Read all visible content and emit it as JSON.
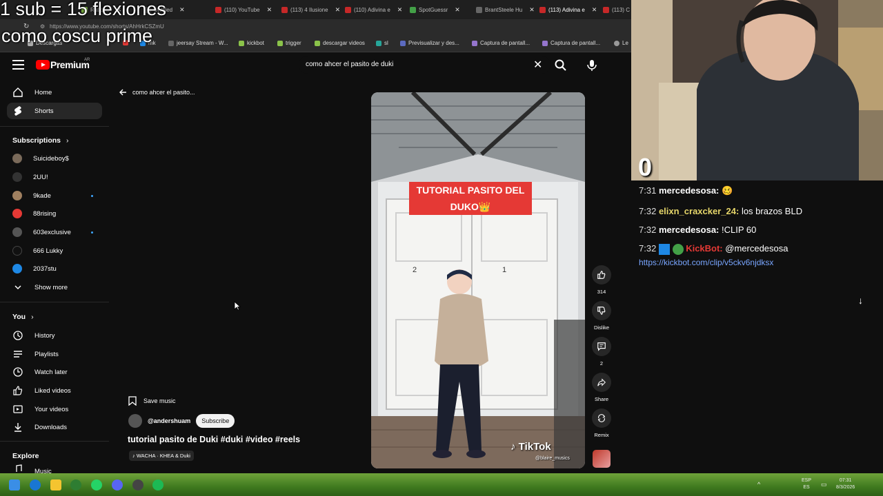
{
  "stream_overlay": {
    "line1": "1 sub = 15 flexiones",
    "line2": "como coscu prime",
    "counter": "0"
  },
  "browser": {
    "tabs": [
      {
        "label": "Ratio ..."
      },
      {
        "label": "Untitled"
      },
      {
        "label": "(110) YouTube"
      },
      {
        "label": "(113) 4 Ilusione"
      },
      {
        "label": "(110) Adivina e"
      },
      {
        "label": "SpotGuessr"
      },
      {
        "label": "BrantSteele Hu"
      },
      {
        "label": "(113) Adivina e"
      },
      {
        "label": "(113) C"
      }
    ],
    "url": "https://www.youtube.com/shorts/AhHrkCSZmU",
    "bookmarks": [
      "Descargas",
      "",
      "mk",
      "jeersay Stream - W...",
      "kickbot",
      "trigger",
      "descargar videos",
      "sl",
      "Previsualizar y des...",
      "Captura de pantall...",
      "Captura de pantall...",
      "Le"
    ]
  },
  "youtube": {
    "logo": "Premium",
    "region": "AR",
    "search_value": "como ahcer el pasito de duki",
    "sidebar": {
      "main": [
        {
          "label": "Home"
        },
        {
          "label": "Shorts"
        }
      ],
      "subscriptions_title": "Subscriptions",
      "subscriptions": [
        {
          "label": "Suicideboy$",
          "color": "#7a6a5a"
        },
        {
          "label": "2UU!",
          "color": "#333333"
        },
        {
          "label": "9kade",
          "color": "#a08060"
        },
        {
          "label": "88rising",
          "color": "#e53935"
        },
        {
          "label": "603exclusive",
          "color": "#555555"
        },
        {
          "label": "666 Lukky",
          "color": "#111111"
        },
        {
          "label": "2037stu",
          "color": "#1e88e5"
        }
      ],
      "show_more": "Show more",
      "you_title": "You",
      "you": [
        {
          "label": "History"
        },
        {
          "label": "Playlists"
        },
        {
          "label": "Watch later"
        },
        {
          "label": "Liked videos"
        },
        {
          "label": "Your videos"
        },
        {
          "label": "Downloads"
        }
      ],
      "explore_title": "Explore",
      "explore_first": "Music"
    },
    "short": {
      "back_text": "como ahcer el pasito...",
      "caption": "TUTORIAL PASITO DEL DUKO👑",
      "save_music": "Save music",
      "channel": "@andershuam",
      "subscribe": "Subscribe",
      "title": "tutorial pasito de Duki #duki #video #reels",
      "music": "WACHA · KHEA & Duki",
      "watermark": "TikTok",
      "watermark_handle": "@blaire_musics",
      "door_numbers": [
        "2",
        "1"
      ],
      "actions": {
        "likes": "314",
        "dislike": "Dislike",
        "comments": "2",
        "share": "Share",
        "remix": "Remix"
      }
    }
  },
  "chat": [
    {
      "time": "7:31",
      "user": "mercedesosa:",
      "user_color": "#ffffff",
      "text": "🥴"
    },
    {
      "time": "7:32",
      "user": "elixn_craxcker_24:",
      "user_color": "#e6d66a",
      "text": "los brazos BLD"
    },
    {
      "time": "7:32",
      "user": "mercedesosa:",
      "user_color": "#ffffff",
      "text": "!CLIP 60"
    },
    {
      "time": "7:32",
      "user": "KickBot:",
      "user_color": "#e53935",
      "text": "@mercedesosa"
    }
  ],
  "chat_link": "https://kickbot.com/clip/v5ckv6njdksx",
  "taskbar": {
    "lang_top": "ESP",
    "lang_bottom": "ES",
    "time": "07:31",
    "date": "8/3/2026"
  }
}
